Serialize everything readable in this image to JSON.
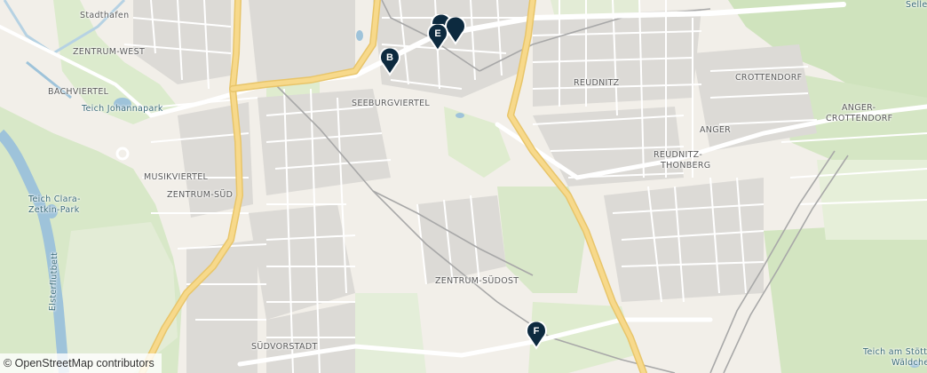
{
  "map": {
    "districts": [
      {
        "id": "stadthafen",
        "text": "Stadthafen"
      },
      {
        "id": "zentrum-west",
        "text": "ZENTRUM-WEST"
      },
      {
        "id": "bachviertel",
        "text": "BACHVIERTEL"
      },
      {
        "id": "seeburgviertel",
        "text": "SEEBURGVIERTEL"
      },
      {
        "id": "reudnitz",
        "text": "REUDNITZ"
      },
      {
        "id": "crottendorf",
        "text": "CROTTENDORF"
      },
      {
        "id": "anger",
        "text": "ANGER"
      },
      {
        "id": "anger-crottendorf-1",
        "text": "ANGER-"
      },
      {
        "id": "anger-crottendorf-2",
        "text": "CROTTENDORF"
      },
      {
        "id": "reudnitz-thonberg-1",
        "text": "REUDNITZ-"
      },
      {
        "id": "reudnitz-thonberg-2",
        "text": "THONBERG"
      },
      {
        "id": "musikviertel",
        "text": "MUSIKVIERTEL"
      },
      {
        "id": "zentrum-sued",
        "text": "ZENTRUM-SÜD"
      },
      {
        "id": "zentrum-suedost",
        "text": "ZENTRUM-SÜDOST"
      },
      {
        "id": "suedvorstadt",
        "text": "SÜDVORSTADT"
      },
      {
        "id": "selle",
        "text": "Selle"
      }
    ],
    "water_labels": [
      {
        "id": "teich-johannapark",
        "text": "Teich Johannapark"
      },
      {
        "id": "teich-clara-1",
        "text": "Teich Clara-"
      },
      {
        "id": "teich-clara-2",
        "text": "Zetkin-Park"
      },
      {
        "id": "flutbett",
        "text": "Elsterflutbett"
      },
      {
        "id": "teich-stoett-1",
        "text": "Teich am Stött"
      },
      {
        "id": "teich-stoett-2",
        "text": "Wäldche"
      }
    ],
    "markers": [
      {
        "id": "B",
        "label": "B",
        "color": "#0d2a3f"
      },
      {
        "id": "E",
        "label": "E",
        "color": "#0d2a3f"
      },
      {
        "id": "F",
        "label": "F",
        "color": "#0d2a3f"
      },
      {
        "id": "cluster-1",
        "label": "",
        "color": "#0d2a3f"
      },
      {
        "id": "cluster-2",
        "label": "",
        "color": "#0d2a3f"
      }
    ],
    "attribution": "© OpenStreetMap contributors"
  }
}
